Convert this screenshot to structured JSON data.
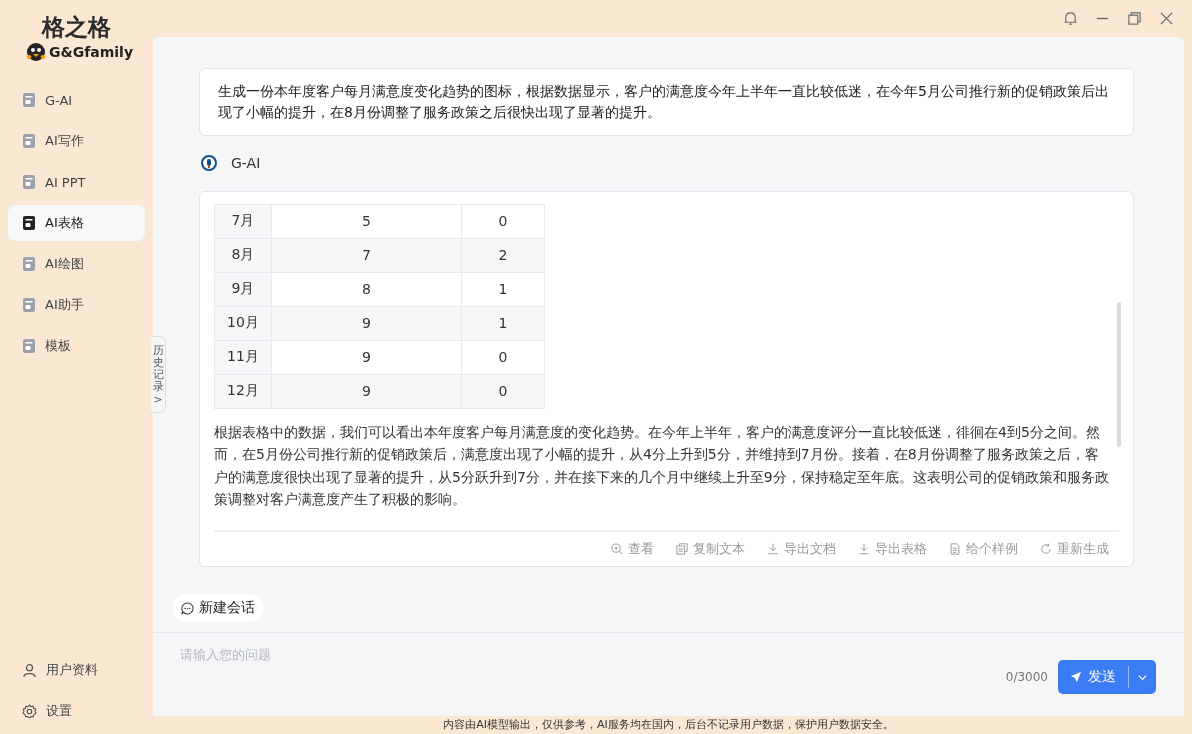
{
  "brand": {
    "title": "格之格",
    "subtitle": "G&Gfamily"
  },
  "sidebar": {
    "items": [
      {
        "label": "G-AI",
        "selected": false
      },
      {
        "label": "AI写作",
        "selected": false
      },
      {
        "label": "AI PPT",
        "selected": false
      },
      {
        "label": "AI表格",
        "selected": true
      },
      {
        "label": "AI绘图",
        "selected": false
      },
      {
        "label": "AI助手",
        "selected": false
      },
      {
        "label": "模板",
        "selected": false
      }
    ],
    "bottom_items": [
      {
        "kind": "user",
        "label": "用户资料"
      },
      {
        "kind": "settings",
        "label": "设置"
      }
    ]
  },
  "history_tab": {
    "label": "历史记录",
    "arrow": ">"
  },
  "user_message": "生成一份本年度客户每月满意度变化趋势的图标，根据数据显示，客户的满意度今年上半年一直比较低迷，在今年5月公司推行新的促销政策后出现了小幅的提升，在8月份调整了服务政策之后很快出现了显著的提升。",
  "assistant": {
    "name": "G-AI",
    "table": {
      "rows": [
        [
          "7月",
          "5",
          "0"
        ],
        [
          "8月",
          "7",
          "2"
        ],
        [
          "9月",
          "8",
          "1"
        ],
        [
          "10月",
          "9",
          "1"
        ],
        [
          "11月",
          "9",
          "0"
        ],
        [
          "12月",
          "9",
          "0"
        ]
      ]
    },
    "paragraph": "根据表格中的数据，我们可以看出本年度客户每月满意度的变化趋势。在今年上半年，客户的满意度评分一直比较低迷，徘徊在4到5分之间。然而，在5月份公司推行新的促销政策后，满意度出现了小幅的提升，从4分上升到5分，并维持到7月份。接着，在8月份调整了服务政策之后，客户的满意度很快出现了显著的提升，从5分跃升到7分，并在接下来的几个月中继续上升至9分，保持稳定至年底。这表明公司的促销政策和服务政策调整对客户满意度产生了积极的影响。",
    "actions": [
      {
        "kind": "view",
        "label": "查看"
      },
      {
        "kind": "copy",
        "label": "复制文本"
      },
      {
        "kind": "download",
        "label": "导出文档"
      },
      {
        "kind": "download",
        "label": "导出表格"
      },
      {
        "kind": "doc",
        "label": "给个样例"
      },
      {
        "kind": "refresh",
        "label": "重新生成"
      }
    ]
  },
  "new_chat": "新建会话",
  "input": {
    "placeholder": "请输入您的问题",
    "counter": "0/3000",
    "send": "发送"
  },
  "footer": "内容由AI模型输出，仅供参考，AI服务均在国内，后台不记录用户数据，保护用户数据安全。"
}
